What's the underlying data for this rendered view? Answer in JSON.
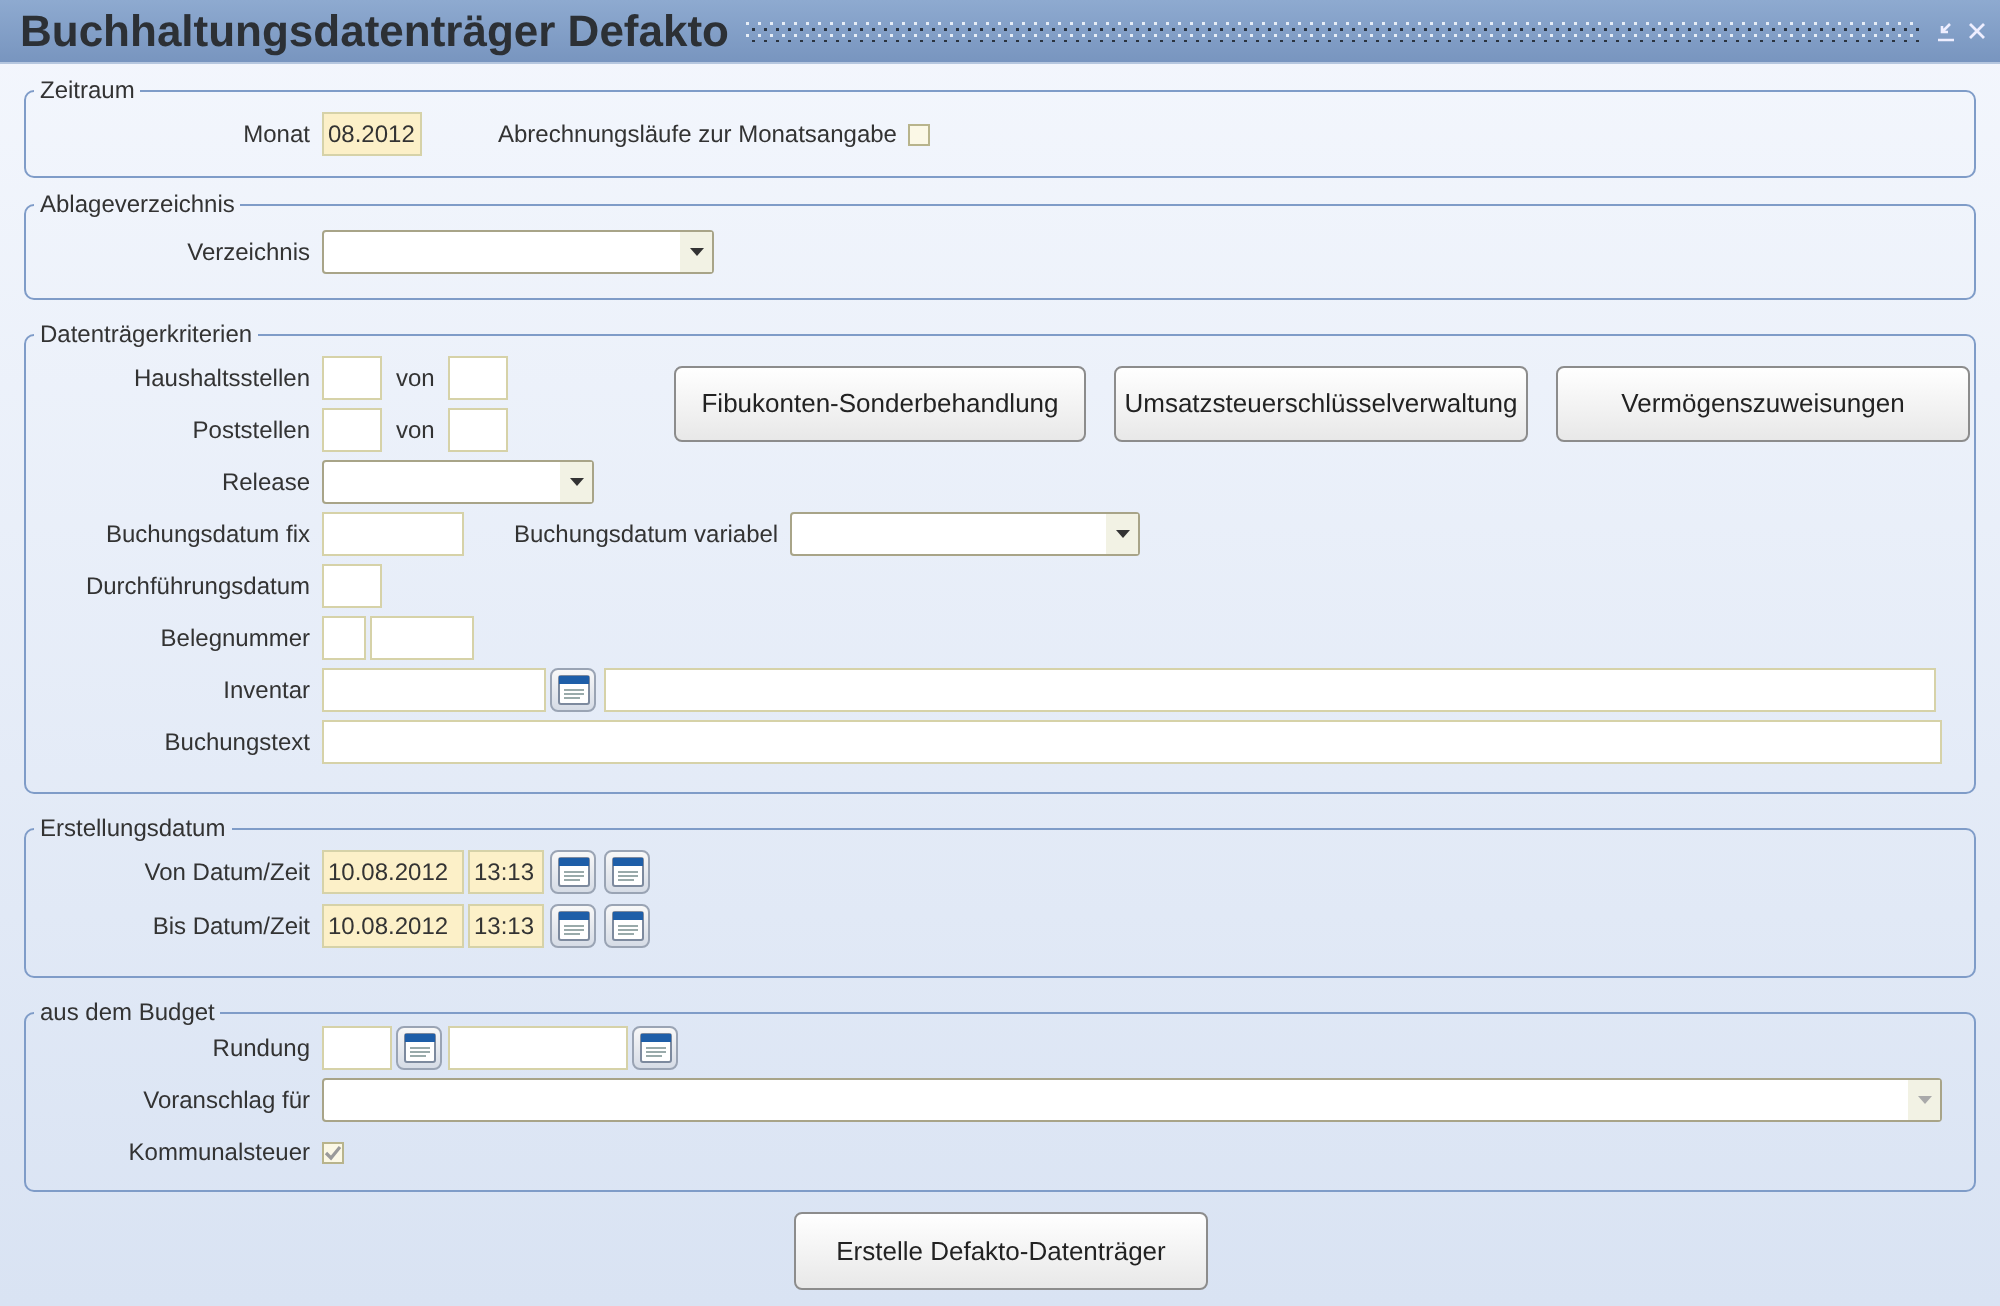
{
  "window": {
    "title": "Buchhaltungsdatenträger Defakto"
  },
  "zeitraum": {
    "legend": "Zeitraum",
    "monat": {
      "label": "Monat",
      "value": "08.2012"
    },
    "abrechnungslaeufe": {
      "label": "Abrechnungsläufe zur Monatsangabe",
      "checked": false
    }
  },
  "ablageverzeichnis": {
    "legend": "Ablageverzeichnis",
    "verzeichnis": {
      "label": "Verzeichnis"
    }
  },
  "datentraegerkriterien": {
    "legend": "Datenträgerkriterien",
    "haushaltsstellen": {
      "label": "Haushaltsstellen",
      "von_label": "von"
    },
    "poststellen": {
      "label": "Poststellen",
      "von_label": "von"
    },
    "release": {
      "label": "Release"
    },
    "buchungsdatum_fix": {
      "label": "Buchungsdatum fix"
    },
    "buchungsdatum_variabel": {
      "label": "Buchungsdatum variabel"
    },
    "durchfuehrungsdatum": {
      "label": "Durchführungsdatum"
    },
    "belegnummer": {
      "label": "Belegnummer"
    },
    "inventar": {
      "label": "Inventar"
    },
    "buchungstext": {
      "label": "Buchungstext"
    },
    "buttons": [
      "Fibukonten-Sonderbehandlung",
      "Umsatzsteuerschlüsselverwaltung",
      "Vermögenszuweisungen"
    ]
  },
  "erstellungsdatum": {
    "legend": "Erstellungsdatum",
    "rows": [
      {
        "label": "Von Datum/Zeit",
        "date": "10.08.2012",
        "time": "13:13"
      },
      {
        "label": "Bis Datum/Zeit",
        "date": "10.08.2012",
        "time": "13:13"
      }
    ]
  },
  "budget": {
    "legend": "aus dem Budget",
    "rundung": {
      "label": "Rundung"
    },
    "voranschlag": {
      "label": "Voranschlag für"
    },
    "kommunalsteuer": {
      "label": "Kommunalsteuer",
      "checked": true
    }
  },
  "action_button": "Erstelle Defakto-Datenträger"
}
